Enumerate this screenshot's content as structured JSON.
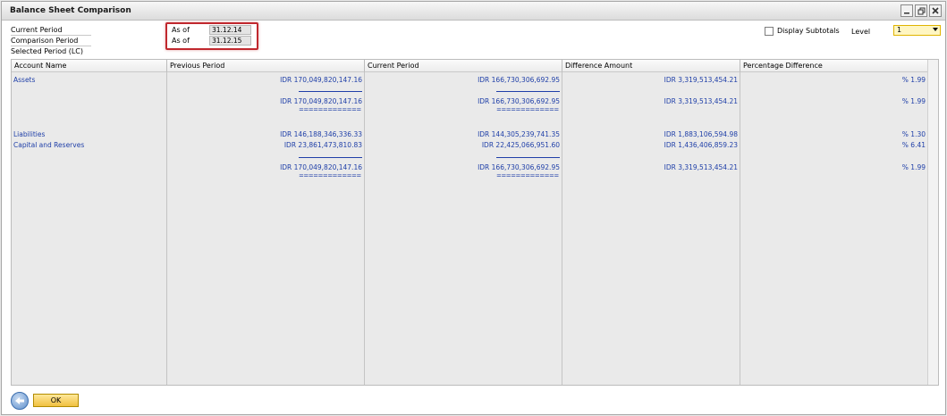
{
  "window": {
    "title": "Balance Sheet Comparison"
  },
  "header": {
    "current_period_label": "Current Period",
    "comparison_period_label": "Comparison Period",
    "selected_period_label": "Selected Period (LC)",
    "current_type": "As of",
    "current_date": "31.12.14",
    "comparison_type": "As of",
    "comparison_date": "31.12.15",
    "display_subtotals_label": "Display Subtotals",
    "level_label": "Level",
    "level_value": "1"
  },
  "table": {
    "columns": [
      "Account Name",
      "Previous Period",
      "Current Period",
      "Difference Amount",
      "Percentage Difference"
    ],
    "underline": "=============",
    "rows": [
      {
        "account": "Assets",
        "prev": "IDR  170,049,820,147.16",
        "curr": "IDR  166,730,306,692.95",
        "diff": "IDR 3,319,513,454.21",
        "pct": "% 1.99"
      },
      {
        "account": "",
        "prev": "IDR  170,049,820,147.16",
        "curr": "IDR  166,730,306,692.95",
        "diff": "IDR 3,319,513,454.21",
        "pct": "% 1.99"
      },
      {
        "account": "Liabilities",
        "prev": "IDR  146,188,346,336.33",
        "curr": "IDR  144,305,239,741.35",
        "diff": "IDR 1,883,106,594.98",
        "pct": "% 1.30"
      },
      {
        "account": "Capital and Reserves",
        "prev": "IDR  23,861,473,810.83",
        "curr": "IDR  22,425,066,951.60",
        "diff": "IDR 1,436,406,859.23",
        "pct": "% 6.41"
      },
      {
        "account": "",
        "prev": "IDR  170,049,820,147.16",
        "curr": "IDR  166,730,306,692.95",
        "diff": "IDR 3,319,513,454.21",
        "pct": "% 1.99"
      }
    ]
  },
  "footer": {
    "ok_label": "OK"
  },
  "colors": {
    "link_text": "#1f3fa8",
    "highlight_border": "#c0282e",
    "ok_button": "#f0c040"
  }
}
